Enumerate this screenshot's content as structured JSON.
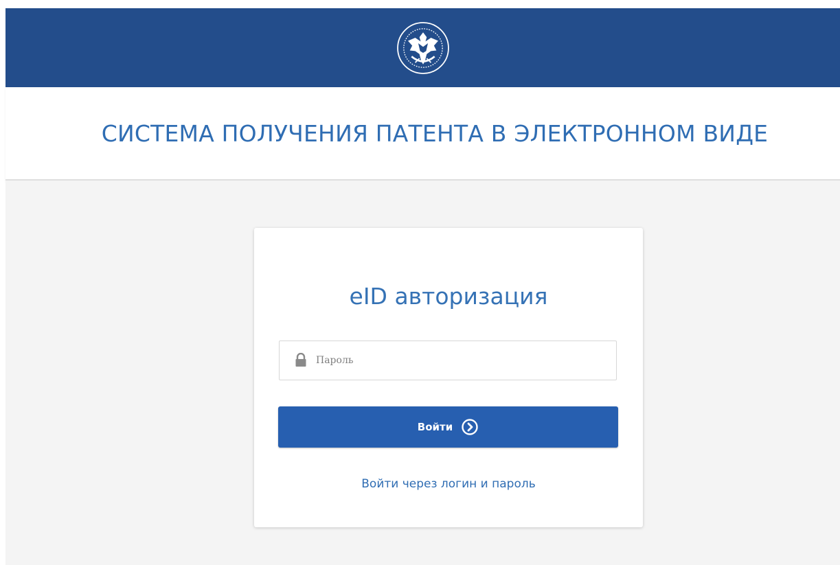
{
  "header": {
    "emblem_icon": "coat-of-arms-icon",
    "background_color": "#234d8b",
    "system_title": "СИСТЕМА ПОЛУЧЕНИЯ ПАТЕНТА В ЭЛЕКТРОННОМ ВИДЕ"
  },
  "login": {
    "title": "eID авторизация",
    "password": {
      "icon": "lock-icon",
      "value": "",
      "placeholder": "Пароль"
    },
    "submit_label": "Войти",
    "submit_icon": "arrow-circle-right-icon",
    "alt_login_link": "Войти через логин и пароль"
  },
  "colors": {
    "accent": "#275fb0",
    "title_text": "#2f6db3",
    "content_background": "#f4f4f4"
  }
}
